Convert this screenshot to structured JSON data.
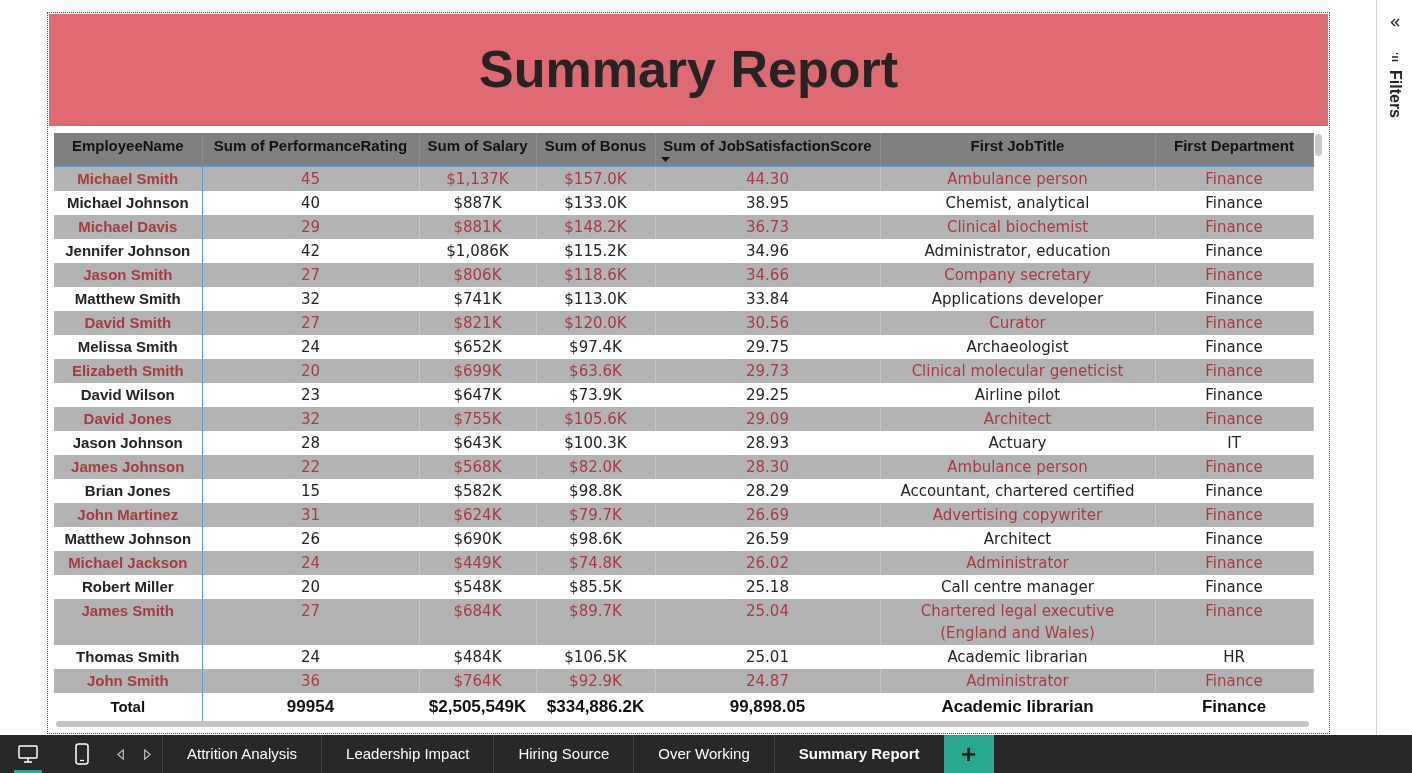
{
  "report": {
    "title": "Summary Report"
  },
  "table": {
    "columns": [
      {
        "label": "EmployeeName",
        "sorted": false
      },
      {
        "label": "Sum of PerformanceRating",
        "sorted": false
      },
      {
        "label": "Sum of Salary",
        "sorted": false
      },
      {
        "label": "Sum of Bonus",
        "sorted": false
      },
      {
        "label": "Sum of JobSatisfactionScore",
        "sorted": true
      },
      {
        "label": "First JobTitle",
        "sorted": false
      },
      {
        "label": "First Department",
        "sorted": false
      }
    ],
    "rows": [
      [
        "Michael Smith",
        "45",
        "$1,137K",
        "$157.0K",
        "44.30",
        "Ambulance person",
        "Finance"
      ],
      [
        "Michael Johnson",
        "40",
        "$887K",
        "$133.0K",
        "38.95",
        "Chemist, analytical",
        "Finance"
      ],
      [
        "Michael Davis",
        "29",
        "$881K",
        "$148.2K",
        "36.73",
        "Clinical biochemist",
        "Finance"
      ],
      [
        "Jennifer Johnson",
        "42",
        "$1,086K",
        "$115.2K",
        "34.96",
        "Administrator, education",
        "Finance"
      ],
      [
        "Jason Smith",
        "27",
        "$806K",
        "$118.6K",
        "34.66",
        "Company secretary",
        "Finance"
      ],
      [
        "Matthew Smith",
        "32",
        "$741K",
        "$113.0K",
        "33.84",
        "Applications developer",
        "Finance"
      ],
      [
        "David Smith",
        "27",
        "$821K",
        "$120.0K",
        "30.56",
        "Curator",
        "Finance"
      ],
      [
        "Melissa Smith",
        "24",
        "$652K",
        "$97.4K",
        "29.75",
        "Archaeologist",
        "Finance"
      ],
      [
        "Elizabeth Smith",
        "20",
        "$699K",
        "$63.6K",
        "29.73",
        "Clinical molecular geneticist",
        "Finance"
      ],
      [
        "David Wilson",
        "23",
        "$647K",
        "$73.9K",
        "29.25",
        "Airline pilot",
        "Finance"
      ],
      [
        "David Jones",
        "32",
        "$755K",
        "$105.6K",
        "29.09",
        "Architect",
        "Finance"
      ],
      [
        "Jason Johnson",
        "28",
        "$643K",
        "$100.3K",
        "28.93",
        "Actuary",
        "IT"
      ],
      [
        "James Johnson",
        "22",
        "$568K",
        "$82.0K",
        "28.30",
        "Ambulance person",
        "Finance"
      ],
      [
        "Brian Jones",
        "15",
        "$582K",
        "$98.8K",
        "28.29",
        "Accountant, chartered certified",
        "Finance"
      ],
      [
        "John Martinez",
        "31",
        "$624K",
        "$79.7K",
        "26.69",
        "Advertising copywriter",
        "Finance"
      ],
      [
        "Matthew Johnson",
        "26",
        "$690K",
        "$98.6K",
        "26.59",
        "Architect",
        "Finance"
      ],
      [
        "Michael Jackson",
        "24",
        "$449K",
        "$74.8K",
        "26.02",
        "Administrator",
        "Finance"
      ],
      [
        "Robert Miller",
        "20",
        "$548K",
        "$85.5K",
        "25.18",
        "Call centre manager",
        "Finance"
      ],
      [
        "James Smith",
        "27",
        "$684K",
        "$89.7K",
        "25.04",
        "Chartered legal executive (England and Wales)",
        "Finance"
      ],
      [
        "Thomas Smith",
        "24",
        "$484K",
        "$106.5K",
        "25.01",
        "Academic librarian",
        "HR"
      ],
      [
        "John Smith",
        "36",
        "$764K",
        "$92.9K",
        "24.87",
        "Administrator",
        "Finance"
      ]
    ],
    "total": [
      "Total",
      "99954",
      "$2,505,549K",
      "$334,886.2K",
      "99,898.05",
      "Academic librarian",
      "Finance"
    ]
  },
  "filters_pane": {
    "label": "Filters"
  },
  "bottom_bar": {
    "views": [
      {
        "kind": "desktop",
        "selected": true
      },
      {
        "kind": "phone",
        "selected": false
      }
    ],
    "pages": [
      {
        "label": "Attrition Analysis",
        "selected": false
      },
      {
        "label": "Leadership Impact",
        "selected": false
      },
      {
        "label": "Hiring Source",
        "selected": false
      },
      {
        "label": "Over Working",
        "selected": false
      },
      {
        "label": "Summary Report",
        "selected": true
      }
    ],
    "add_page": "+"
  }
}
